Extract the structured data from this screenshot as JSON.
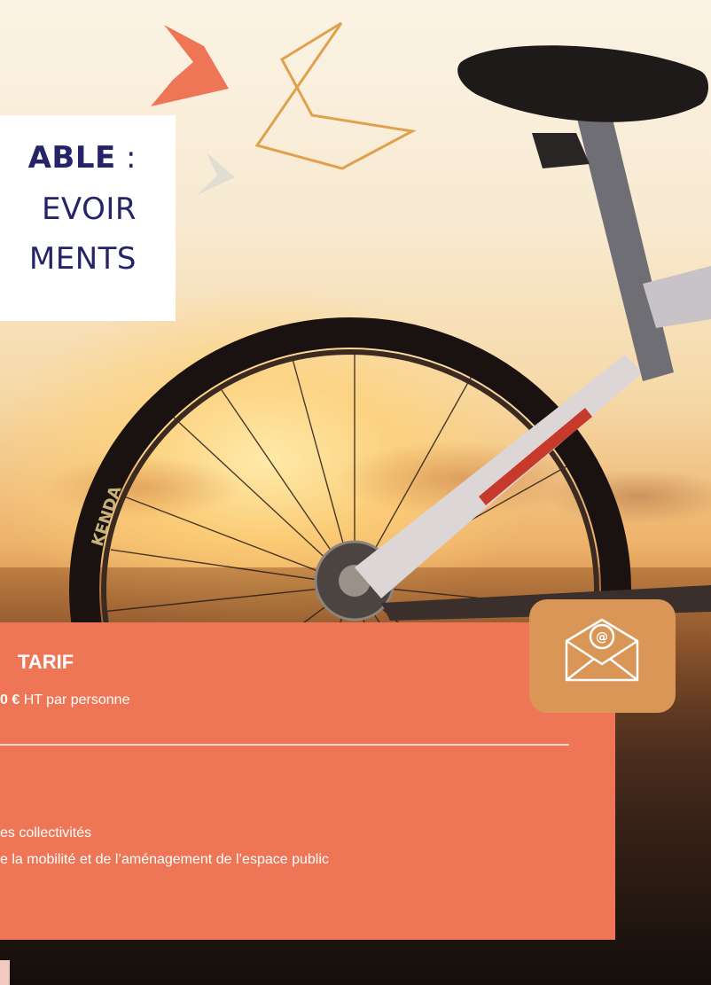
{
  "title": {
    "line1_bold": "ABLE",
    "line1_tail": " :",
    "line2": "EVOIR",
    "line3": "MENTS"
  },
  "tarif": {
    "heading": "TARIF",
    "price_bold": "0 €",
    "price_rest": " HT par personne"
  },
  "audience": {
    "line1": "es collectivités",
    "line2": "e la mobilité et de l’aménagement de l’espace public"
  },
  "tire_brand": "KENDA",
  "colors": {
    "panel_orange": "#ee7656",
    "badge_tan": "#d99656",
    "title_navy": "#262468",
    "chevron_coral": "#ee7656",
    "chevron_gold": "#e0a14e"
  },
  "icons": {
    "email": "envelope-at-icon"
  }
}
